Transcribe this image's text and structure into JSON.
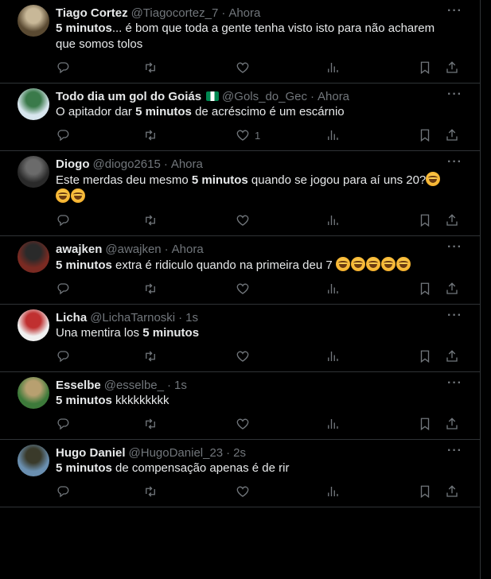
{
  "tweets": [
    {
      "name": "Tiago Cortez",
      "handle": "@Tiagocortez_7",
      "time": "Ahora",
      "flag": false,
      "avatar_colors": [
        "#5a4a32",
        "#c8b898"
      ],
      "segments": [
        {
          "t": "5 minutos",
          "b": true
        },
        {
          "t": "... é bom que toda a gente tenha visto isto para não acharem que somos tolos",
          "b": false
        }
      ],
      "emojis": 0,
      "likes": ""
    },
    {
      "name": "Todo dia um gol do Goiás",
      "handle": "@Gols_do_Gec",
      "time": "Ahora",
      "flag": true,
      "avatar_colors": [
        "#d8e6ee",
        "#3a7a4a"
      ],
      "segments": [
        {
          "t": "O apitador dar ",
          "b": false
        },
        {
          "t": "5 minutos",
          "b": true
        },
        {
          "t": " de acréscimo é um escárnio",
          "b": false
        }
      ],
      "emojis": 0,
      "likes": "1"
    },
    {
      "name": "Diogo",
      "handle": "@diogo2615",
      "time": "Ahora",
      "flag": false,
      "avatar_colors": [
        "#2a2a2a",
        "#6b6b6b"
      ],
      "segments": [
        {
          "t": "Este merdas deu mesmo ",
          "b": false
        },
        {
          "t": "5 minutos",
          "b": true
        },
        {
          "t": " quando se jogou para aí uns 20?",
          "b": false
        }
      ],
      "emojis": 3,
      "likes": ""
    },
    {
      "name": "awajken",
      "handle": "@awajken",
      "time": "Ahora",
      "flag": false,
      "avatar_colors": [
        "#7a2a22",
        "#2a2a2a"
      ],
      "segments": [
        {
          "t": "5 minutos",
          "b": true
        },
        {
          "t": " extra é ridiculo quando na primeira deu 7 ",
          "b": false
        }
      ],
      "emojis": 5,
      "likes": ""
    },
    {
      "name": "Licha",
      "handle": "@LichaTarnoski",
      "time": "1s",
      "flag": false,
      "avatar_colors": [
        "#f0f0f0",
        "#c03030"
      ],
      "segments": [
        {
          "t": "Una mentira los ",
          "b": false
        },
        {
          "t": "5 minutos",
          "b": true
        }
      ],
      "emojis": 0,
      "likes": ""
    },
    {
      "name": "Esselbe",
      "handle": "@esselbe_",
      "time": "1s",
      "flag": false,
      "avatar_colors": [
        "#3d7a3a",
        "#b8a070"
      ],
      "segments": [
        {
          "t": "5 minutos",
          "b": true
        },
        {
          "t": " kkkkkkkkk",
          "b": false
        }
      ],
      "emojis": 0,
      "likes": ""
    },
    {
      "name": "Hugo Daniel",
      "handle": "@HugoDaniel_23",
      "time": "2s",
      "flag": false,
      "avatar_colors": [
        "#6a8fb0",
        "#3a3a2a"
      ],
      "segments": [
        {
          "t": "5 minutos",
          "b": true
        },
        {
          "t": " de compensação apenas é de rir",
          "b": false
        }
      ],
      "emojis": 0,
      "likes": ""
    }
  ],
  "time_separator": "·",
  "more_label": "···",
  "icons": [
    "reply-icon",
    "retweet-icon",
    "like-icon",
    "views-icon",
    "bookmark-icon",
    "share-icon"
  ],
  "colors": {
    "background": "#000000",
    "text": "#e7e9ea",
    "muted": "#71767b",
    "border": "#2f3336"
  }
}
